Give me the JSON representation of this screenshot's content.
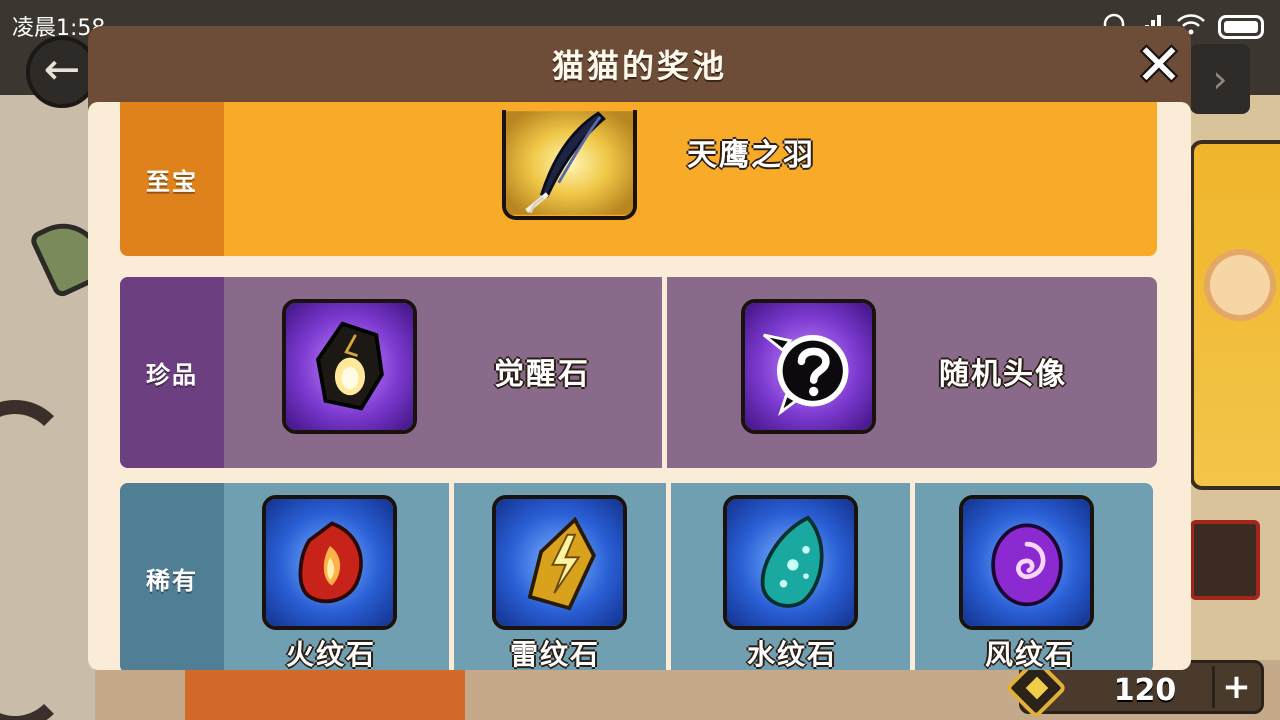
{
  "status_bar": {
    "time": "凌晨1:58",
    "icons": [
      "headphones-icon",
      "signal-icon",
      "wifi-icon",
      "battery-icon"
    ]
  },
  "game": {
    "currency_value": "120",
    "currency_plus": "+",
    "back_glyph": "←",
    "next_glyph": "›"
  },
  "dialog": {
    "title": "猫猫的奖池",
    "close_glyph": "✕",
    "tiers": [
      {
        "label": "至宝",
        "color": "#f8ab28",
        "items": [
          {
            "name": "天鹰之羽",
            "icon": "feather-icon"
          }
        ]
      },
      {
        "label": "珍品",
        "color": "#8a6a8a",
        "items": [
          {
            "name": "觉醒石",
            "icon": "awakening-stone-icon"
          },
          {
            "name": "随机头像",
            "icon": "random-avatar-icon"
          }
        ]
      },
      {
        "label": "稀有",
        "color": "#6f9fb1",
        "items": [
          {
            "name": "火纹石",
            "icon": "fire-stone-icon"
          },
          {
            "name": "雷纹石",
            "icon": "thunder-stone-icon"
          },
          {
            "name": "水纹石",
            "icon": "water-stone-icon"
          },
          {
            "name": "风纹石",
            "icon": "wind-stone-icon"
          }
        ]
      }
    ]
  }
}
